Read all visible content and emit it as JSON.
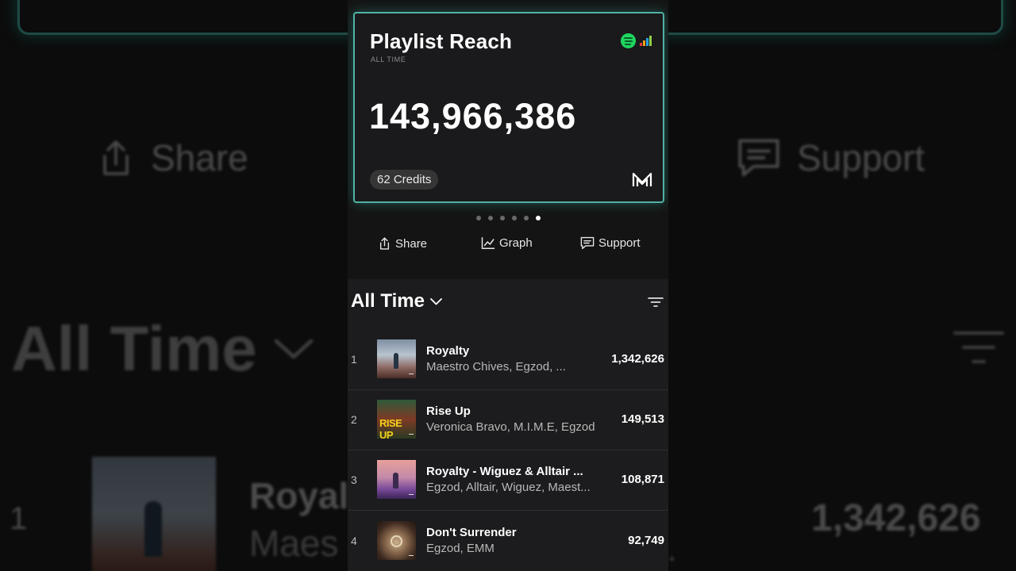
{
  "card": {
    "title": "Playlist Reach",
    "subtitle": "ALL TIME",
    "value": "143,966,386",
    "credits": "62 Credits",
    "accent_color": "#4fb3a5",
    "icons": [
      "spotify-icon",
      "deezer-icon",
      "brand-logo-icon"
    ]
  },
  "carousel": {
    "count": 6,
    "active_index": 5
  },
  "actions": {
    "share_label": "Share",
    "graph_label": "Graph",
    "support_label": "Support"
  },
  "list": {
    "period_label": "All Time",
    "items": [
      {
        "rank": "1",
        "title": "Royalty",
        "artists": "Maestro Chives, Egzod, ...",
        "streams": "1,342,626"
      },
      {
        "rank": "2",
        "title": "Rise Up",
        "artists": "Veronica Bravo, M.I.M.E, Egzod",
        "streams": "149,513"
      },
      {
        "rank": "3",
        "title": "Royalty - Wiguez & Alltair ...",
        "artists": "Egzod, Alltair, Wiguez, Maest...",
        "streams": "108,871"
      },
      {
        "rank": "4",
        "title": "Don't Surrender",
        "artists": "Egzod, EMM",
        "streams": "92,749"
      }
    ]
  },
  "background": {
    "share_label": "Share",
    "support_label": "Support",
    "period_label": "All Time",
    "rank": "1",
    "title_fragment": "Royal",
    "artist_fragment": "Maes",
    "streams": "1,342,626",
    "ellipsis": "..."
  }
}
